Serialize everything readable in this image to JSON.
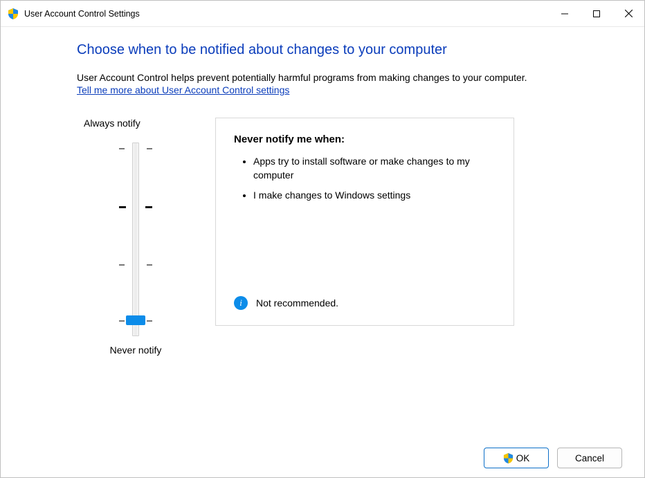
{
  "titlebar": {
    "title": "User Account Control Settings"
  },
  "heading": "Choose when to be notified about changes to your computer",
  "description": "User Account Control helps prevent potentially harmful programs from making changes to your computer.",
  "help_link": "Tell me more about User Account Control settings",
  "slider": {
    "top_label": "Always notify",
    "bottom_label": "Never notify"
  },
  "panel": {
    "heading": "Never notify me when:",
    "bullets": [
      "Apps try to install software or make changes to my computer",
      "I make changes to Windows settings"
    ],
    "status": "Not recommended."
  },
  "buttons": {
    "ok": "OK",
    "cancel": "Cancel"
  }
}
